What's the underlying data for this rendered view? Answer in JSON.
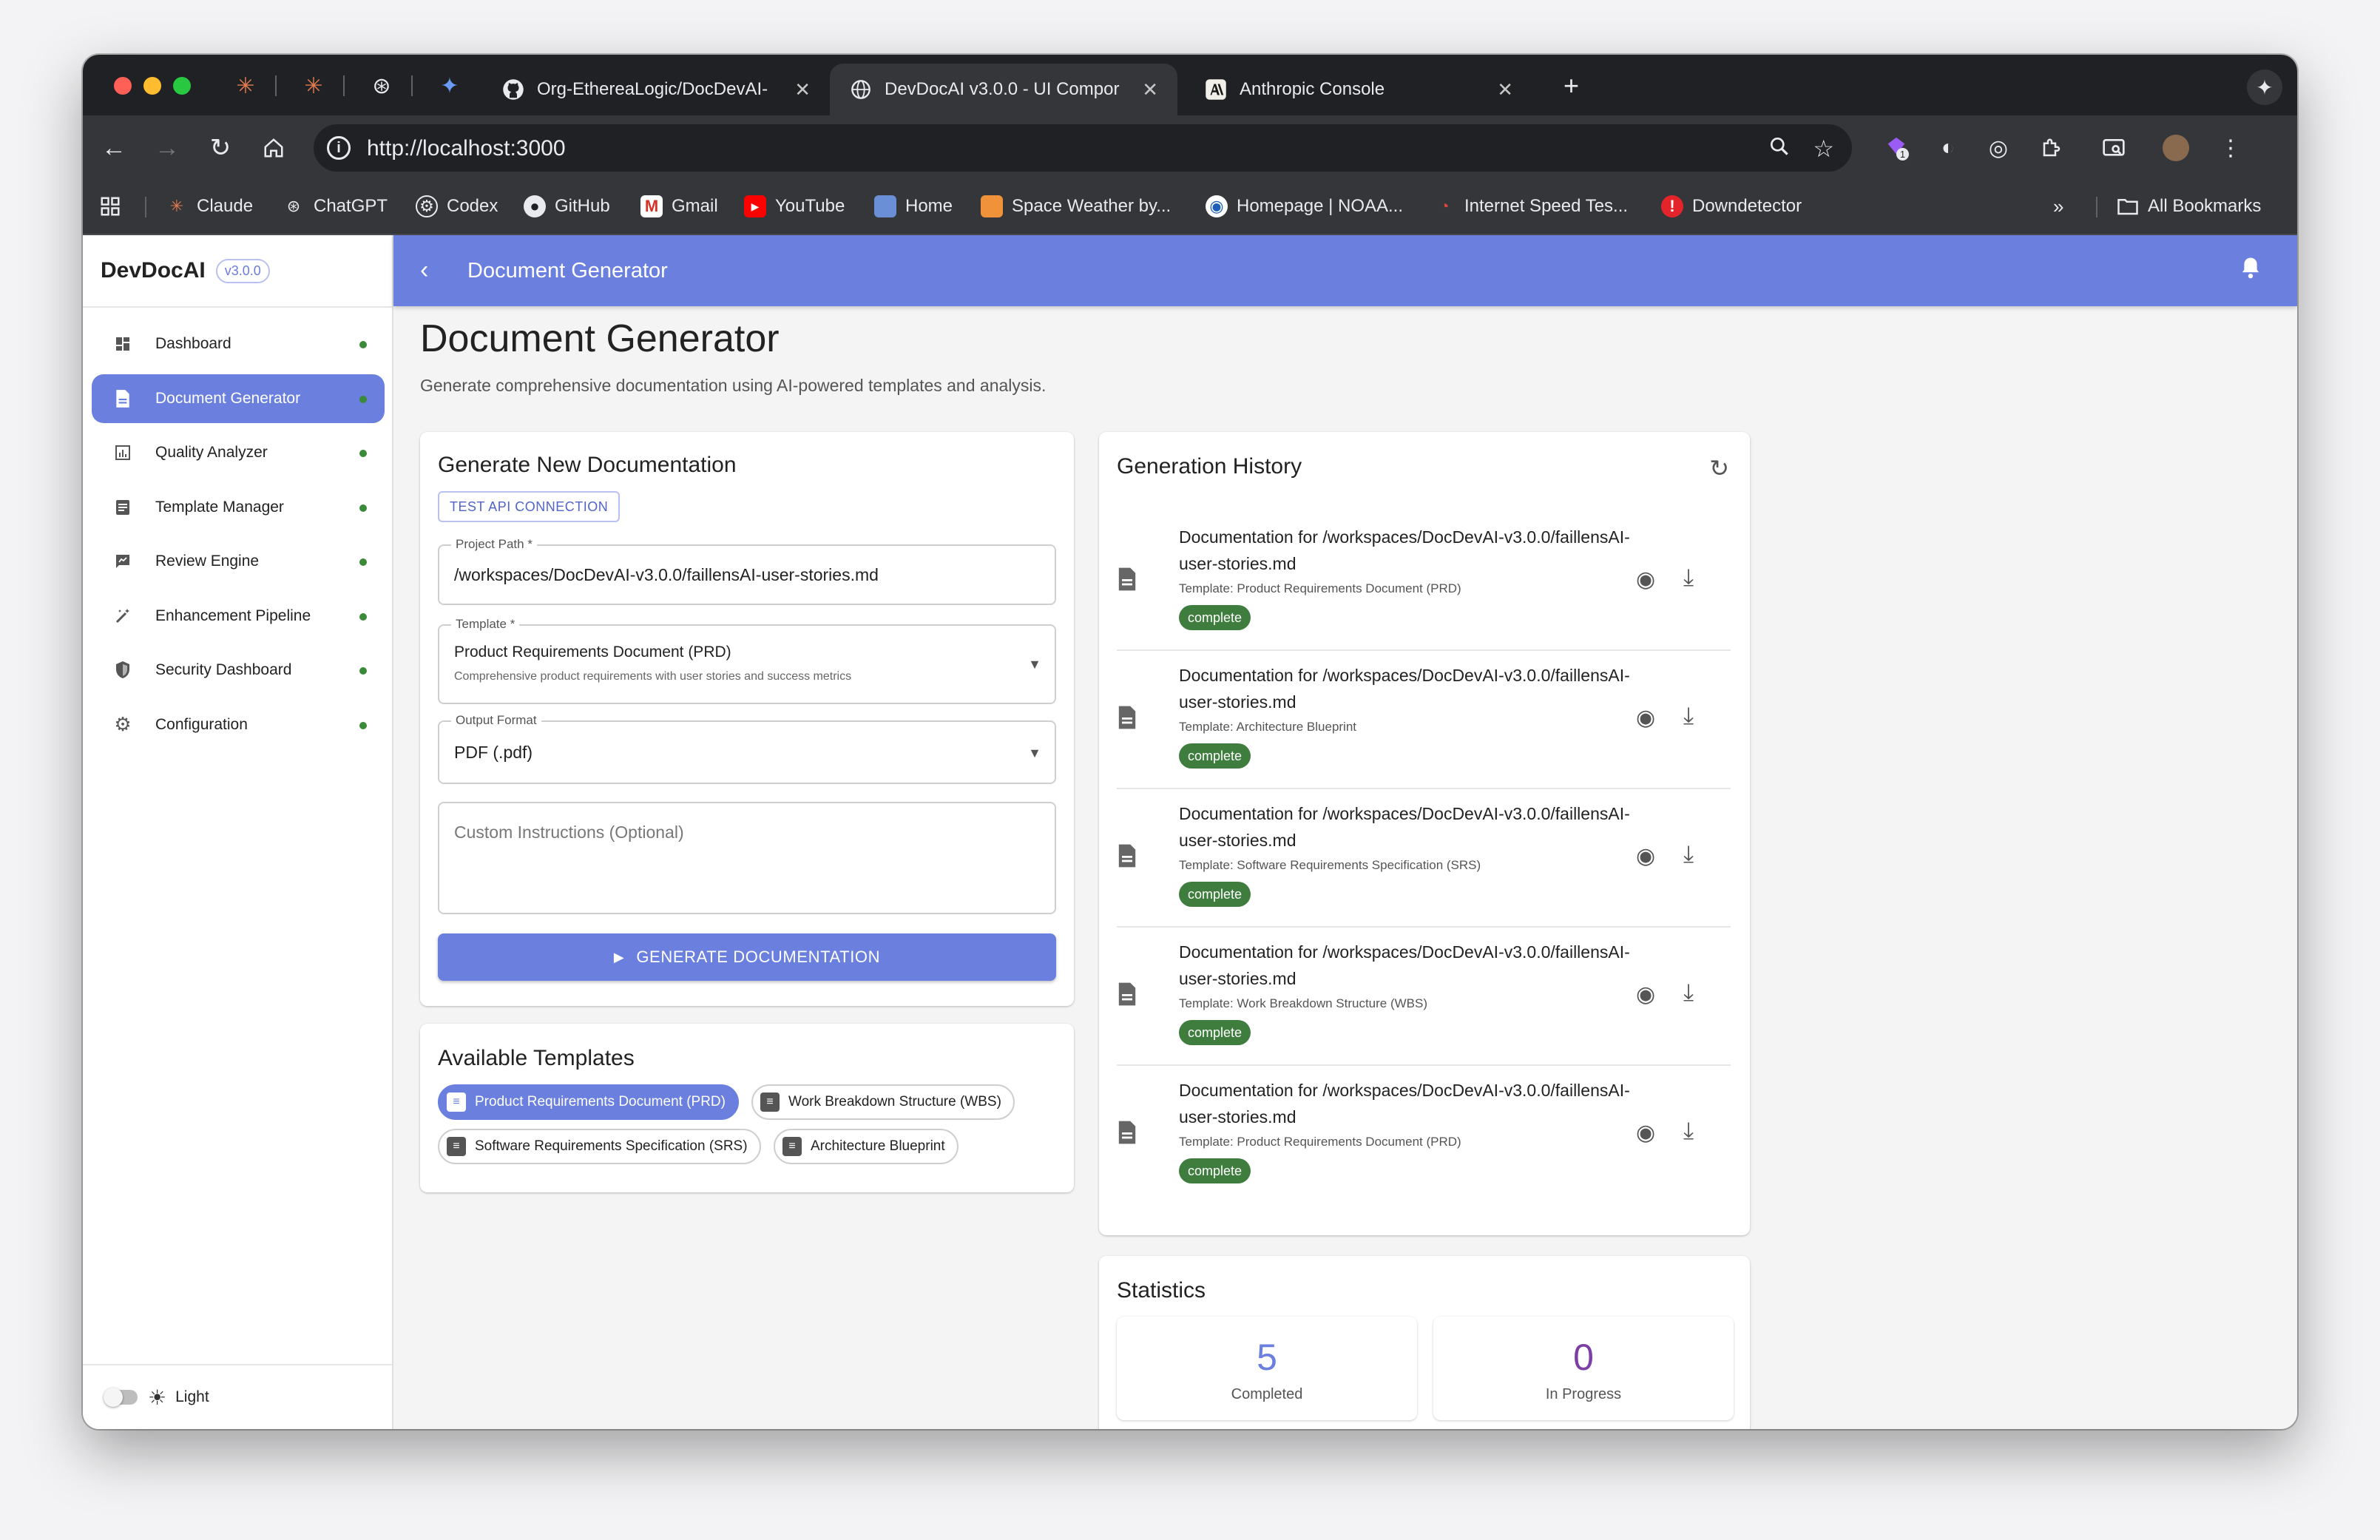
{
  "browser": {
    "pinned_tabs": [
      {
        "icon": "claude-icon",
        "glyph": "✳"
      },
      {
        "icon": "claude-icon",
        "glyph": "✳"
      },
      {
        "icon": "chatgpt-icon",
        "glyph": "⊛"
      },
      {
        "icon": "gemini-icon",
        "glyph": "✦"
      }
    ],
    "tabs": [
      {
        "title": "Org-EthereaLogic/DocDevAI-",
        "icon": "github-icon",
        "active": false
      },
      {
        "title": "DevDocAI v3.0.0 - UI Compor",
        "icon": "globe-icon",
        "active": true
      },
      {
        "title": "Anthropic Console",
        "icon": "anthropic-icon",
        "active": false
      }
    ],
    "url": "http://localhost:3000",
    "extension_badge": "1",
    "bookmarks": [
      {
        "label": "Claude",
        "icon": "claude-icon"
      },
      {
        "label": "ChatGPT",
        "icon": "chatgpt-icon"
      },
      {
        "label": "Codex",
        "icon": "codex-icon"
      },
      {
        "label": "GitHub",
        "icon": "github-icon"
      },
      {
        "label": "Gmail",
        "icon": "gmail-icon"
      },
      {
        "label": "YouTube",
        "icon": "youtube-icon"
      },
      {
        "label": "Home",
        "icon": "home-icon"
      },
      {
        "label": "Space Weather by...",
        "icon": "space-weather-icon"
      },
      {
        "label": "Homepage | NOAA...",
        "icon": "noaa-icon"
      },
      {
        "label": "Internet Speed Tes...",
        "icon": "speedtest-icon"
      },
      {
        "label": "Downdetector",
        "icon": "downdetector-icon"
      }
    ],
    "all_bookmarks": "All Bookmarks"
  },
  "app": {
    "brand": "DevDocAI",
    "version": "v3.0.0",
    "nav": [
      {
        "label": "Dashboard",
        "icon": "dashboard-icon",
        "active": false
      },
      {
        "label": "Document Generator",
        "icon": "document-icon",
        "active": true
      },
      {
        "label": "Quality Analyzer",
        "icon": "analytics-icon",
        "active": false
      },
      {
        "label": "Template Manager",
        "icon": "template-icon",
        "active": false
      },
      {
        "label": "Review Engine",
        "icon": "review-icon",
        "active": false
      },
      {
        "label": "Enhancement Pipeline",
        "icon": "magic-wand-icon",
        "active": false
      },
      {
        "label": "Security Dashboard",
        "icon": "shield-icon",
        "active": false
      },
      {
        "label": "Configuration",
        "icon": "gear-icon",
        "active": false
      }
    ],
    "theme_label": "Light",
    "appbar_title": "Document Generator"
  },
  "page": {
    "title": "Document Generator",
    "subtitle": "Generate comprehensive documentation using AI-powered templates and analysis."
  },
  "generate": {
    "title": "Generate New Documentation",
    "test_button": "TEST API CONNECTION",
    "project_path_label": "Project Path *",
    "project_path_value": "/workspaces/DocDevAI-v3.0.0/faillensAI-user-stories.md",
    "template_label": "Template *",
    "template_value": "Product Requirements Document (PRD)",
    "template_desc": "Comprehensive product requirements with user stories and success metrics",
    "format_label": "Output Format",
    "format_value": "PDF (.pdf)",
    "instructions_placeholder": "Custom Instructions (Optional)",
    "generate_button": "GENERATE DOCUMENTATION"
  },
  "templates": {
    "title": "Available Templates",
    "items": [
      {
        "label": "Product Requirements Document (PRD)",
        "active": true
      },
      {
        "label": "Work Breakdown Structure (WBS)",
        "active": false
      },
      {
        "label": "Software Requirements Specification (SRS)",
        "active": false
      },
      {
        "label": "Architecture Blueprint",
        "active": false
      }
    ]
  },
  "history": {
    "title": "Generation History",
    "items": [
      {
        "title": "Documentation for /workspaces/DocDevAI-v3.0.0/faillensAI-user-stories.md",
        "template": "Template: Product Requirements Document (PRD)",
        "status": "complete"
      },
      {
        "title": "Documentation for /workspaces/DocDevAI-v3.0.0/faillensAI-user-stories.md",
        "template": "Template: Architecture Blueprint",
        "status": "complete"
      },
      {
        "title": "Documentation for /workspaces/DocDevAI-v3.0.0/faillensAI-user-stories.md",
        "template": "Template: Software Requirements Specification (SRS)",
        "status": "complete"
      },
      {
        "title": "Documentation for /workspaces/DocDevAI-v3.0.0/faillensAI-user-stories.md",
        "template": "Template: Work Breakdown Structure (WBS)",
        "status": "complete"
      },
      {
        "title": "Documentation for /workspaces/DocDevAI-v3.0.0/faillensAI-user-stories.md",
        "template": "Template: Product Requirements Document (PRD)",
        "status": "complete"
      }
    ]
  },
  "statistics": {
    "title": "Statistics",
    "completed_value": "5",
    "completed_label": "Completed",
    "in_progress_value": "0",
    "in_progress_label": "In Progress"
  },
  "colors": {
    "primary": "#6a7fde",
    "success": "#3f7d3f",
    "completed_stat": "#6a7fde",
    "in_progress_stat": "#7b3fa6"
  }
}
